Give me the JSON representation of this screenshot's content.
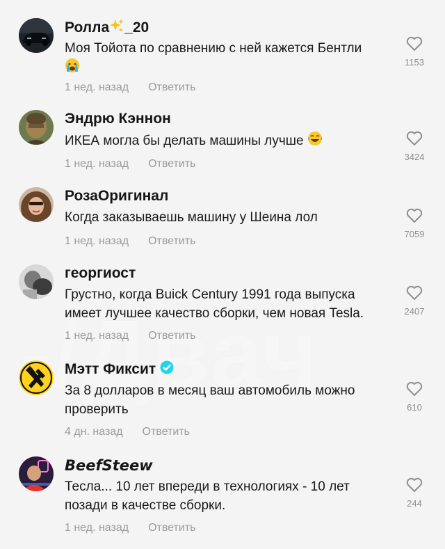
{
  "comments": [
    {
      "username": "Ролла",
      "username_suffix": "_20",
      "text": "Моя Тойота по сравнению с ней кажется Бентли",
      "time": "1 нед. назад",
      "reply": "Ответить",
      "likes": "1153"
    },
    {
      "username": "Эндрю Кэннон",
      "text": "ИКЕА могла бы делать машины лучше",
      "time": "1 нед. назад",
      "reply": "Ответить",
      "likes": "3424"
    },
    {
      "username": "РозаОригинал",
      "text": "Когда заказываешь машину у Шеина лол",
      "time": "1 нед. назад",
      "reply": "Ответить",
      "likes": "7059"
    },
    {
      "username": "георгиост",
      "text_line1": "Грустно, когда Buick Century 1991 года выпуска",
      "text_line2": "имеет лучшее качество сборки, чем новая Tesla.",
      "time": "1 нед. назад",
      "reply": "Ответить",
      "likes": "2407"
    },
    {
      "username": "Мэтт Фиксит",
      "text_line1": "За 8 долларов в месяц ваш автомобиль можно",
      "text_line2": "проверить",
      "time": "4 дн. назад",
      "reply": "Ответить",
      "likes": "610"
    },
    {
      "username": "BeefSteew",
      "text_line1": "Тесла... 10 лет впереди в технологиях - 10 лет",
      "text_line2": "позади в качестве сборки.",
      "time": "1 нед. назад",
      "reply": "Ответить",
      "likes": "244"
    }
  ],
  "watermark": "-/Двач",
  "colors": {
    "background": "#f4f4f4",
    "meta": "#9a9a9a",
    "verified": "#20d5ec"
  }
}
